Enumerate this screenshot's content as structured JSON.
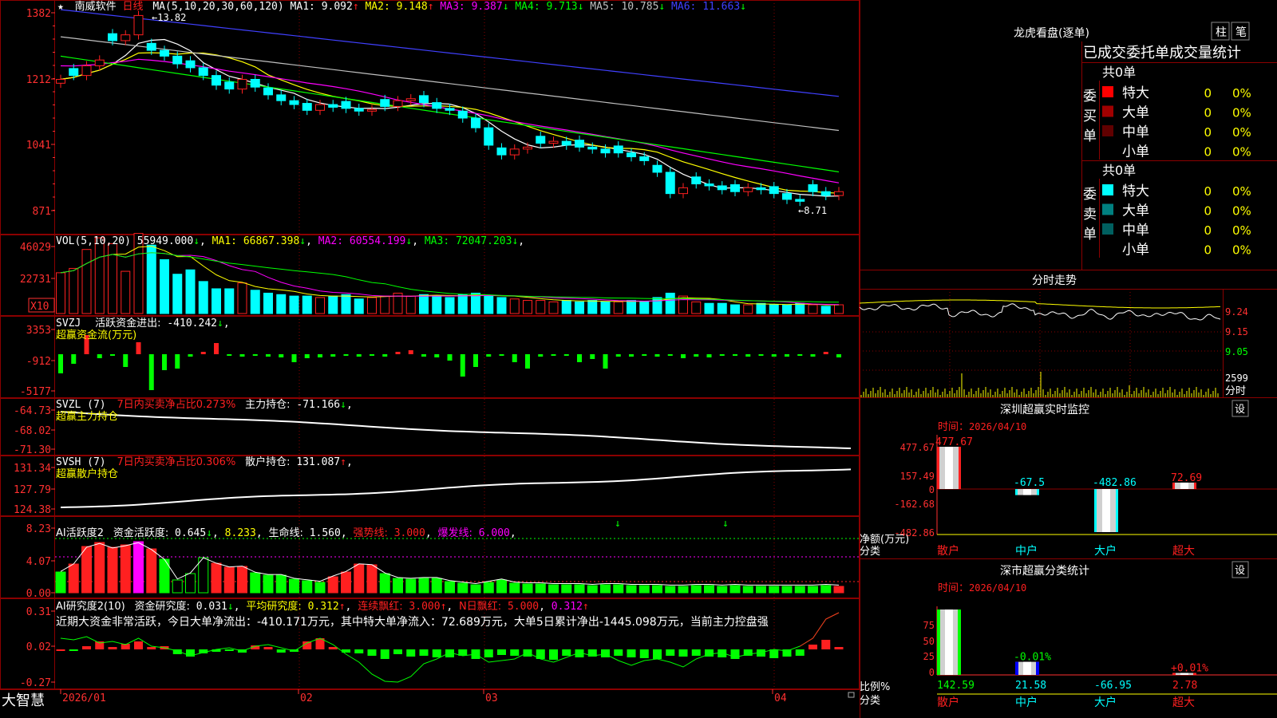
{
  "app": {
    "brand": "大智慧"
  },
  "stock": {
    "name": "南威软件",
    "period": "日线",
    "marker": "★"
  },
  "colors": {
    "up": "#ff2020",
    "down": "#00ffff",
    "grid": "#8b0000",
    "axis": "#ff3030",
    "ma1": "#ffffff",
    "ma2": "#ffff00",
    "ma3": "#ff00ff",
    "ma4": "#00ff00",
    "ma5": "#c0c0c0",
    "ma6": "#4040ff",
    "green": "#00ff00",
    "yellow": "#ffff00"
  },
  "price_panel": {
    "title": "MA(5,10,20,30,60,120)",
    "values": [
      {
        "label": "MA1:",
        "value": "9.092",
        "arrow": "↑",
        "color": "#ffffff"
      },
      {
        "label": "MA2:",
        "value": "9.148",
        "arrow": "↑",
        "color": "#ffff00"
      },
      {
        "label": "MA3:",
        "value": "9.387",
        "arrow": "↓",
        "color": "#ff00ff"
      },
      {
        "label": "MA4:",
        "value": "9.713",
        "arrow": "↓",
        "color": "#00ff00"
      },
      {
        "label": "MA5:",
        "value": "10.785",
        "arrow": "↓",
        "color": "#c0c0c0"
      },
      {
        "label": "MA6:",
        "value": "11.663",
        "arrow": "↓",
        "color": "#4040ff"
      }
    ],
    "yticks": [
      "1382",
      "1212",
      "1041",
      "871"
    ],
    "high_label": "13.82",
    "low_label": "8.71",
    "high_arrow": "←",
    "low_arrow": "←"
  },
  "vol_panel": {
    "title": "VOL(5,10,20)",
    "values": [
      {
        "label": "",
        "value": "55949.000",
        "arrow": "↓",
        "color": "#ffffff"
      },
      {
        "label": "MA1:",
        "value": "66867.398",
        "arrow": "↓",
        "color": "#ffff00"
      },
      {
        "label": "MA2:",
        "value": "60554.199",
        "arrow": "↓",
        "color": "#ff00ff"
      },
      {
        "label": "MA3:",
        "value": "72047.203",
        "arrow": "↓",
        "color": "#00ff00"
      }
    ],
    "yticks": [
      "46029",
      "22731"
    ],
    "unit": "X10"
  },
  "svzj_panel": {
    "title": "SVZJ",
    "label": "活跃资金进出:",
    "value": "-410.242",
    "arrow": "↓",
    "sub": "超赢资金流(万元)",
    "yticks": [
      "3353",
      "-912",
      "-5177"
    ]
  },
  "svzl_panel": {
    "title": "SVZL (7)",
    "label1": "7日内买卖净占比0.273%",
    "label2": "主力持仓:",
    "value": "-71.166",
    "arrow": "↓",
    "sub": "超赢主力持仓",
    "yticks": [
      "-64.73",
      "-68.02",
      "-71.30"
    ]
  },
  "svsh_panel": {
    "title": "SVSH (7)",
    "label1": "7日内买卖净占比0.306%",
    "label2": "散户持仓:",
    "value": "131.087",
    "arrow": "↑",
    "sub": "超赢散户持仓",
    "yticks": [
      "131.34",
      "127.79",
      "124.38"
    ]
  },
  "ai2_panel": {
    "title": "AI活跃度2",
    "label": "资金活跃度:",
    "value": "0.645",
    "arrow": "↓",
    "value2": "8.233",
    "label3": "生命线:",
    "value3": "1.560",
    "label4": "强势线:",
    "value4": "3.000",
    "label5": "爆发线:",
    "value5": "6.000",
    "yticks": [
      "8.23",
      "4.07",
      "0.00"
    ]
  },
  "ai_research_panel": {
    "title": "AI研究度2(10)",
    "label": "资金研究度:",
    "value": "0.031",
    "arrow": "↓",
    "label2": "平均研究度:",
    "value2": "0.312",
    "label3": "连续飘红:",
    "value3": "3.000",
    "label4": "N日飘红:",
    "value4": "5.000",
    "value5": "0.312",
    "comment": "近期大资金非常活跃，今日大单净流出：-410.171万元，其中特大单净流入：72.689万元，大单5日累计净出-1445.098万元，当前主力控盘强",
    "yticks": [
      "0.31",
      "0.02",
      "-0.27"
    ]
  },
  "xaxis": {
    "labels": [
      "2026/01",
      "02",
      "03",
      "04"
    ]
  },
  "dragon": {
    "title": "龙虎看盘(逐单)",
    "btn1": "柱",
    "btn2": "笔",
    "subtitle": "已成交委托单成交量统计",
    "buy": {
      "side": "委买单",
      "total": "共0单",
      "rows": [
        {
          "name": "特大",
          "count": "0",
          "pct": "0%",
          "color": "#ff0000"
        },
        {
          "name": "大单",
          "count": "0",
          "pct": "0%",
          "color": "#a00000"
        },
        {
          "name": "中单",
          "count": "0",
          "pct": "0%",
          "color": "#600000"
        },
        {
          "name": "小单",
          "count": "0",
          "pct": "0%",
          "color": ""
        }
      ]
    },
    "sell": {
      "side": "委卖单",
      "total": "共0单",
      "rows": [
        {
          "name": "特大",
          "count": "0",
          "pct": "0%",
          "color": "#00ffff"
        },
        {
          "name": "大单",
          "count": "0",
          "pct": "0%",
          "color": "#008080"
        },
        {
          "name": "中单",
          "count": "0",
          "pct": "0%",
          "color": "#006060"
        },
        {
          "name": "小单",
          "count": "0",
          "pct": "0%",
          "color": ""
        }
      ]
    }
  },
  "intraday": {
    "title": "分时走势",
    "yticks": [
      "9.24",
      "9.15",
      "9.05"
    ],
    "vol_tick": "2599",
    "vol_label": "分时"
  },
  "sz_monitor": {
    "title": "深圳超赢实时监控",
    "btn": "设",
    "time_label": "时间：",
    "time": "2026/04/10",
    "yticks": [
      "477.67",
      "157.49",
      "0",
      "-162.68",
      "-482.86"
    ],
    "ylabel1": "净额(万元)",
    "ylabel2": "分类",
    "bars": [
      {
        "cat": "散户",
        "value": 477.67,
        "label": "477.67",
        "color": "#ff2020"
      },
      {
        "cat": "中户",
        "value": -67.5,
        "label": "-67.5",
        "color": "#00ffff"
      },
      {
        "cat": "大户",
        "value": -482.86,
        "label": "-482.86",
        "color": "#00ffff"
      },
      {
        "cat": "超大",
        "value": 72.69,
        "label": "72.69",
        "color": "#ff2020"
      }
    ]
  },
  "sz_classify": {
    "title": "深市超赢分类统计",
    "btn": "设",
    "time_label": "时间：",
    "time": "2026/04/10",
    "yticks": [
      "75",
      "50",
      "25",
      "0"
    ],
    "ylabel1": "比例%",
    "ylabel2": "分类",
    "bars": [
      {
        "cat": "散户",
        "pct": 100,
        "pct_label": "",
        "value": "142.59",
        "color": "#00ff00"
      },
      {
        "cat": "中户",
        "pct": 20,
        "pct_label": "-0.01%",
        "value": "21.58",
        "color": "#0000ff"
      },
      {
        "cat": "大户",
        "pct": 0,
        "pct_label": "",
        "value": "-66.95",
        "color": "#00ffff"
      },
      {
        "cat": "超大",
        "pct": 3,
        "pct_label": "+0.01%",
        "value": "2.78",
        "color": "#ff2020"
      }
    ]
  }
}
